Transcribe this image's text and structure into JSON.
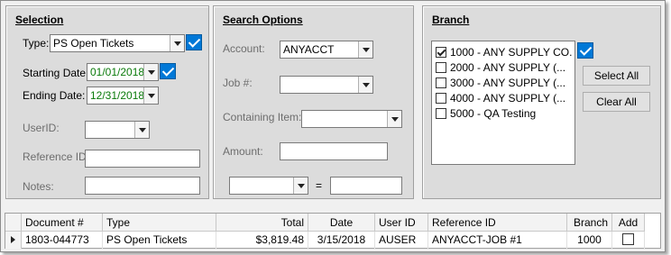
{
  "selection": {
    "title": "Selection",
    "type_label": "Type:",
    "type_value": "PS Open Tickets",
    "starting_date_label": "Starting Date:",
    "starting_date_value": "01/01/2018",
    "ending_date_label": "Ending Date:",
    "ending_date_value": "12/31/2018",
    "userid_label": "UserID:",
    "userid_value": "",
    "reference_id_label": "Reference ID:",
    "reference_id_value": "",
    "notes_label": "Notes:",
    "notes_value": ""
  },
  "search_options": {
    "title": "Search Options",
    "account_label": "Account:",
    "account_value": "ANYACCT",
    "job_label": "Job #:",
    "job_value": "",
    "containing_item_label": "Containing Item:",
    "containing_item_value": "",
    "amount_label": "Amount:",
    "amount_value": "",
    "operator_value": "",
    "equals_label": "=",
    "compare_value": ""
  },
  "branch": {
    "title": "Branch",
    "items": [
      {
        "label": "1000 - ANY SUPPLY CO.",
        "checked": true
      },
      {
        "label": "2000 - ANY SUPPLY (...",
        "checked": false
      },
      {
        "label": "3000 - ANY SUPPLY (...",
        "checked": false
      },
      {
        "label": "4000 - ANY SUPPLY (...",
        "checked": false
      },
      {
        "label": "5000 - QA Testing",
        "checked": false
      }
    ],
    "select_all_label": "Select All",
    "clear_all_label": "Clear All"
  },
  "grid": {
    "columns": [
      "Document #",
      "Type",
      "Total",
      "Date",
      "User ID",
      "Reference ID",
      "Branch",
      "Add"
    ],
    "rows": [
      {
        "document": "1803-044773",
        "type": "PS Open Tickets",
        "total": "$3,819.48",
        "date": "3/15/2018",
        "user_id": "AUSER",
        "reference_id": "ANYACCT-JOB #1",
        "branch": "1000",
        "add": false
      }
    ]
  },
  "colors": {
    "accent": "#0078d7",
    "date_text": "#0a7a0a",
    "panel_bg": "#dcdcdc"
  }
}
